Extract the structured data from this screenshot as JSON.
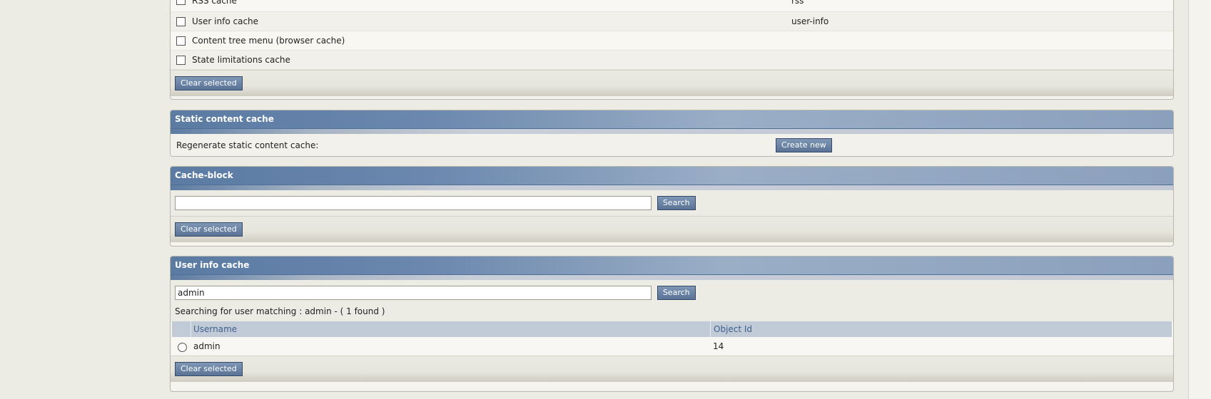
{
  "cache_list": {
    "rows": [
      {
        "label": "RSS cache",
        "id": "rss"
      },
      {
        "label": "User info cache",
        "id": "user-info"
      },
      {
        "label": "Content tree menu (browser cache)",
        "id": ""
      },
      {
        "label": "State limitations cache",
        "id": ""
      }
    ],
    "clear_label": "Clear selected"
  },
  "static_cache": {
    "title": "Static content cache",
    "label": "Regenerate static content cache:",
    "button_label": "Create new"
  },
  "cache_block": {
    "title": "Cache-block",
    "search_value": "",
    "search_label": "Search",
    "clear_label": "Clear selected"
  },
  "user_info_cache": {
    "title": "User info cache",
    "search_value": "admin",
    "search_label": "Search",
    "result_text": "Searching for user matching : admin - ( 1 found )",
    "columns": {
      "username": "Username",
      "object_id": "Object Id"
    },
    "rows": [
      {
        "username": "admin",
        "object_id": "14"
      }
    ],
    "clear_label": "Clear selected"
  }
}
